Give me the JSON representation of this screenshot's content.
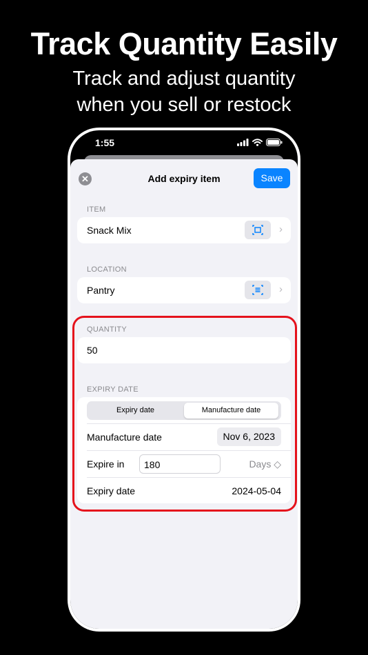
{
  "promo": {
    "headline": "Track Quantity Easily",
    "subline_1": "Track and adjust quantity",
    "subline_2": "when you sell or restock"
  },
  "status_bar": {
    "time": "1:55"
  },
  "nav": {
    "close_glyph": "✕",
    "title": "Add expiry item",
    "save_label": "Save"
  },
  "item_section": {
    "label": "ITEM",
    "value": "Snack Mix"
  },
  "location_section": {
    "label": "LOCATION",
    "value": "Pantry"
  },
  "quantity_section": {
    "label": "QUANTITY",
    "value": "50"
  },
  "expiry_section": {
    "label": "EXPIRY DATE",
    "segments": [
      "Expiry date",
      "Manufacture date"
    ],
    "selected_segment": "Manufacture date",
    "manufacture_date_label": "Manufacture date",
    "manufacture_date_value": "Nov 6, 2023",
    "expire_in_label": "Expire in",
    "expire_in_value": "180",
    "expire_in_unit": "Days ◇",
    "expiry_date_label": "Expiry date",
    "expiry_date_value": "2024-05-04"
  },
  "icons": {
    "close": "close-icon",
    "scan": "barcode-scan-icon",
    "chevron": "chevron-right-icon",
    "signal": "cellular-signal-icon",
    "wifi": "wifi-icon",
    "battery": "battery-icon"
  },
  "colors": {
    "accent": "#0a84ff",
    "highlight": "#e5121c",
    "background": "#f2f2f7"
  }
}
